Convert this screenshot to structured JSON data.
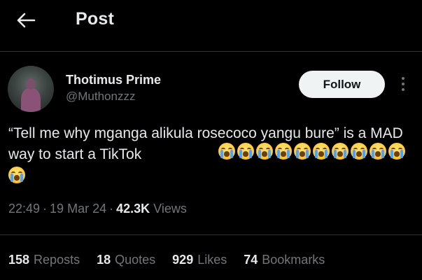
{
  "header": {
    "back_icon": "arrow-left-icon",
    "title": "Post"
  },
  "author": {
    "display_name": "Thotimus Prime",
    "handle": "@Muthonzzz",
    "follow_label": "Follow",
    "more_icon": "more-vertical-icon"
  },
  "tweet": {
    "text": "“Tell me why mganga alikula rosecoco yangu bure” is a MAD way to start a TikTok",
    "emoji_name": "loudly-crying-face-icon",
    "emoji_count": 11
  },
  "meta": {
    "time": "22:49",
    "date": "19 Mar 24",
    "views_count": "42.3K",
    "views_label": "Views"
  },
  "stats": [
    {
      "count": "158",
      "label": "Reposts"
    },
    {
      "count": "18",
      "label": "Quotes"
    },
    {
      "count": "929",
      "label": "Likes"
    },
    {
      "count": "74",
      "label": "Bookmarks"
    }
  ],
  "colors": {
    "background": "#000000",
    "primary_text": "#e7e9ea",
    "secondary_text": "#71767b",
    "divider": "#2f3336",
    "follow_bg": "#eff3f4"
  }
}
